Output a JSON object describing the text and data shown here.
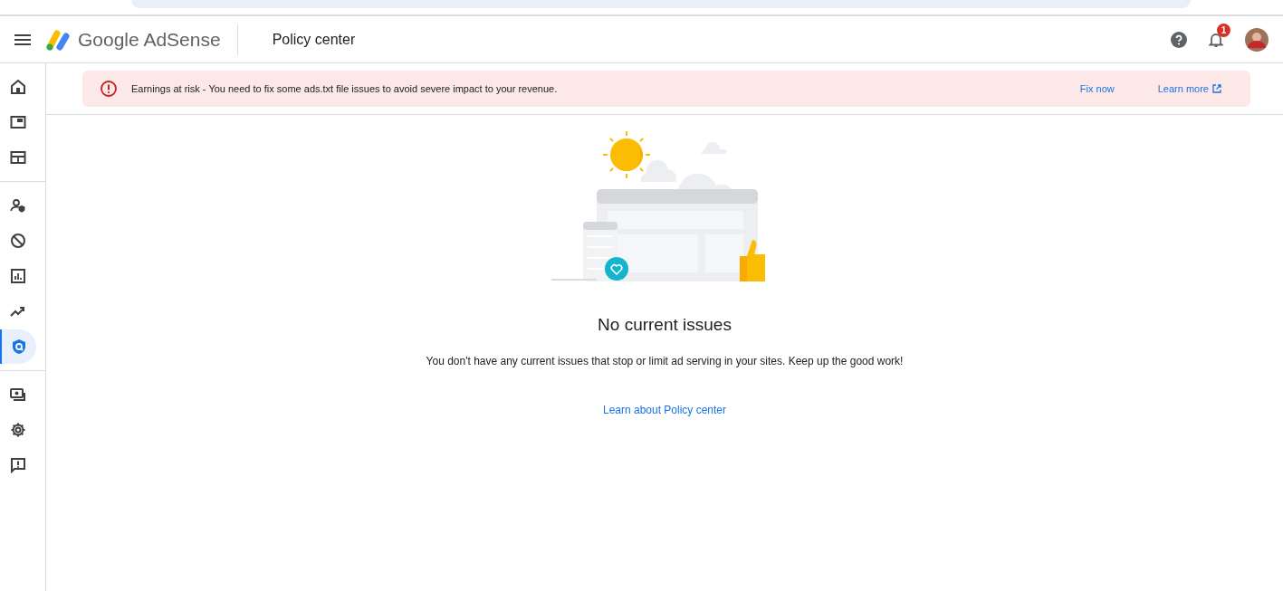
{
  "header": {
    "product": "Google AdSense",
    "page_title": "Policy center",
    "notification_count": "1"
  },
  "sidebar": {
    "groups": [
      [
        {
          "kind": "home",
          "selected": false
        },
        {
          "kind": "ads",
          "selected": false
        },
        {
          "kind": "sites",
          "selected": false
        }
      ],
      [
        {
          "kind": "privacy",
          "selected": false
        },
        {
          "kind": "blocking",
          "selected": false
        },
        {
          "kind": "reports",
          "selected": false
        },
        {
          "kind": "optimization",
          "selected": false
        },
        {
          "kind": "policy",
          "selected": true
        }
      ],
      [
        {
          "kind": "payments",
          "selected": false
        },
        {
          "kind": "settings",
          "selected": false
        },
        {
          "kind": "feedback",
          "selected": false
        }
      ]
    ]
  },
  "alert": {
    "message": "Earnings at risk - You need to fix some ads.txt file issues to avoid severe impact to your revenue.",
    "actions": [
      {
        "label": "Fix now",
        "external": false
      },
      {
        "label": "Learn more",
        "external": true
      }
    ]
  },
  "empty_state": {
    "title": "No current issues",
    "description": "You don't have any current issues that stop or limit ad serving in your sites. Keep up the good work!",
    "link": "Learn about Policy center"
  }
}
